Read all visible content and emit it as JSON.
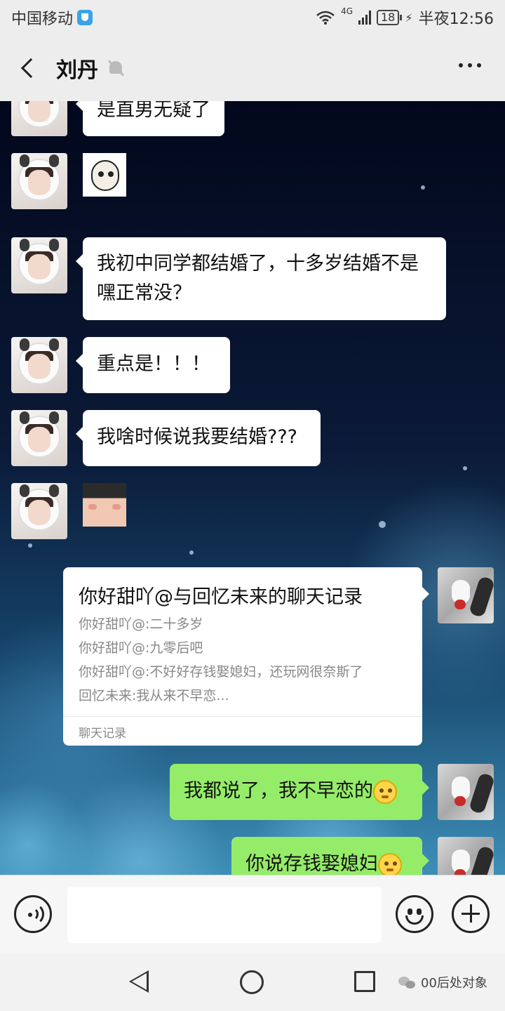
{
  "status_bar": {
    "carrier": "中国移动",
    "network": "4G",
    "battery": "18",
    "time": "半夜12:56"
  },
  "header": {
    "title": "刘丹",
    "muted_icon": "bell-muted-icon",
    "more_icon": "more-dots-icon"
  },
  "messages": [
    {
      "side": "left",
      "type": "text",
      "text": "是直男无疑了"
    },
    {
      "side": "left",
      "type": "sticker",
      "sticker": "panda-face-sticker"
    },
    {
      "side": "left",
      "type": "text",
      "lines": [
        "我初中同学都结婚了，十多岁结婚不是",
        "嘿正常没？"
      ]
    },
    {
      "side": "left",
      "type": "text",
      "text": "重点是！！！"
    },
    {
      "side": "left",
      "type": "text",
      "text": "我啥时候说我要结婚???"
    },
    {
      "side": "left",
      "type": "sticker",
      "sticker": "crying-kid-sticker"
    },
    {
      "side": "right",
      "type": "chat_record"
    },
    {
      "side": "right",
      "type": "text",
      "text": "我都说了，我不早恋的"
    },
    {
      "side": "right",
      "type": "text",
      "text": "你说存钱娶媳妇"
    }
  ],
  "chat_record": {
    "title": "你好甜吖@与回忆未来的聊天记录",
    "lines": [
      "你好甜吖@:二十多岁",
      "你好甜吖@:九零后吧",
      "你好甜吖@:不好好存钱娶媳妇，还玩网很奈斯了",
      "回忆未来:我从来不早恋..."
    ],
    "footer": "聊天记录"
  },
  "input_bar": {
    "voice_icon": "voice-icon",
    "emoji_icon": "emoji-icon",
    "plus_icon": "plus-icon",
    "placeholder": ""
  },
  "nav_bar": {
    "watermark": "00后处对象"
  },
  "colors": {
    "bubble_mine": "#95ec69",
    "bubble_theirs": "#ffffff",
    "chrome": "#ededed"
  }
}
